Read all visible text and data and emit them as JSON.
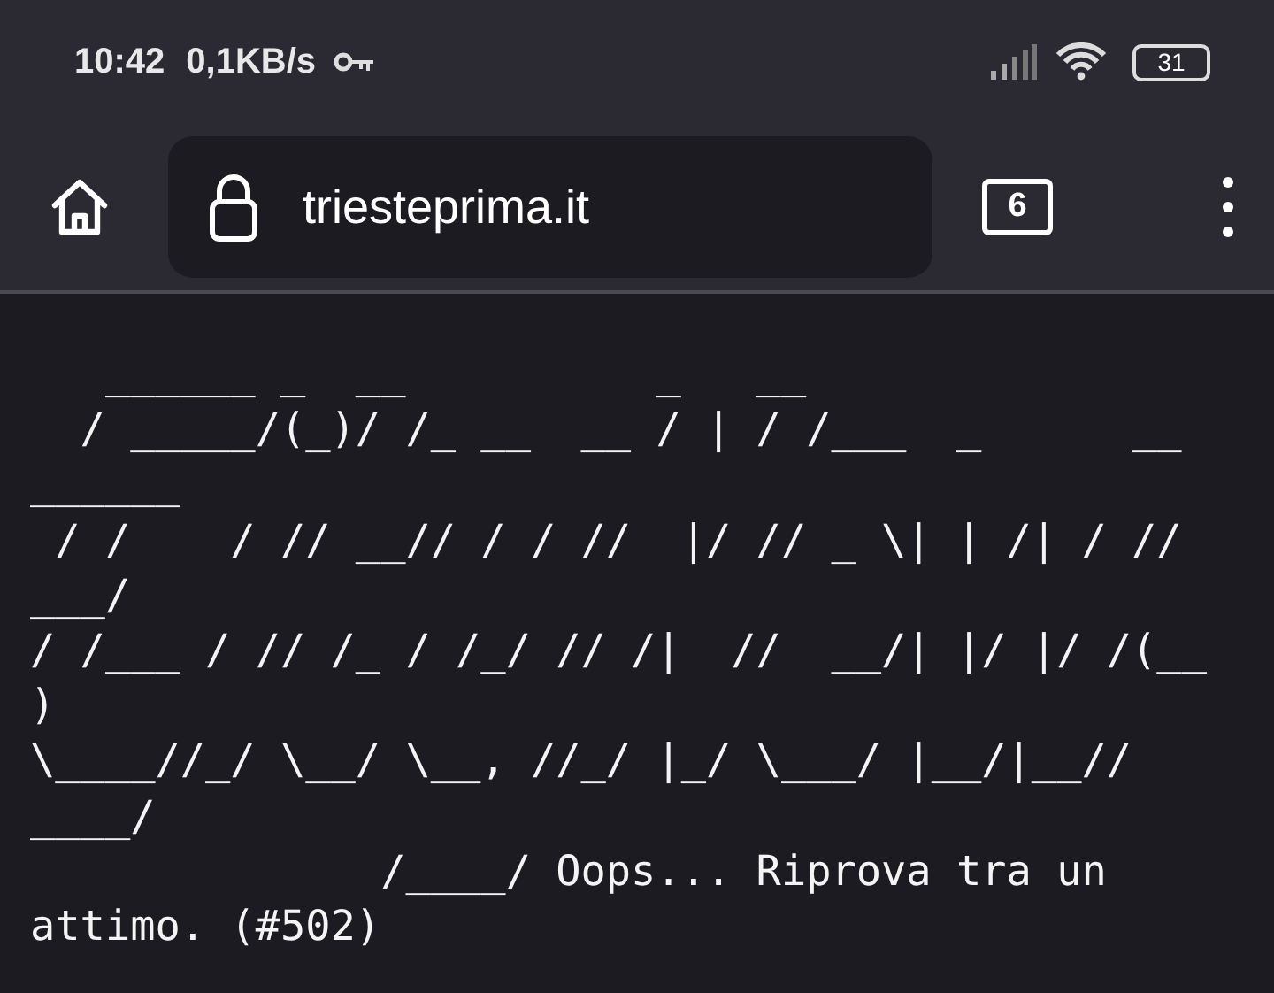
{
  "status_bar": {
    "time": "10:42",
    "network_speed": "0,1KB/s",
    "battery": "31"
  },
  "toolbar": {
    "url": "triesteprima.it",
    "tab_count": "6"
  },
  "page": {
    "lines": [
      "   ______ _  __          _   __",
      "  / _____/(_)/ /_ __  __ / | / /___  _      __",
      "______",
      " / /    / // __// / / //  |/ // _ \\| | /| / //",
      "___/",
      "/ /___ / // /_ / /_/ // /|  //  __/| |/ |/ /(__",
      ")",
      "\\____//_/ \\__/ \\__, //_/ |_/ \\___/ |__/|__//",
      "____/",
      "              /____/ Oops... Riprova tra un",
      "attimo. (#502)"
    ]
  }
}
